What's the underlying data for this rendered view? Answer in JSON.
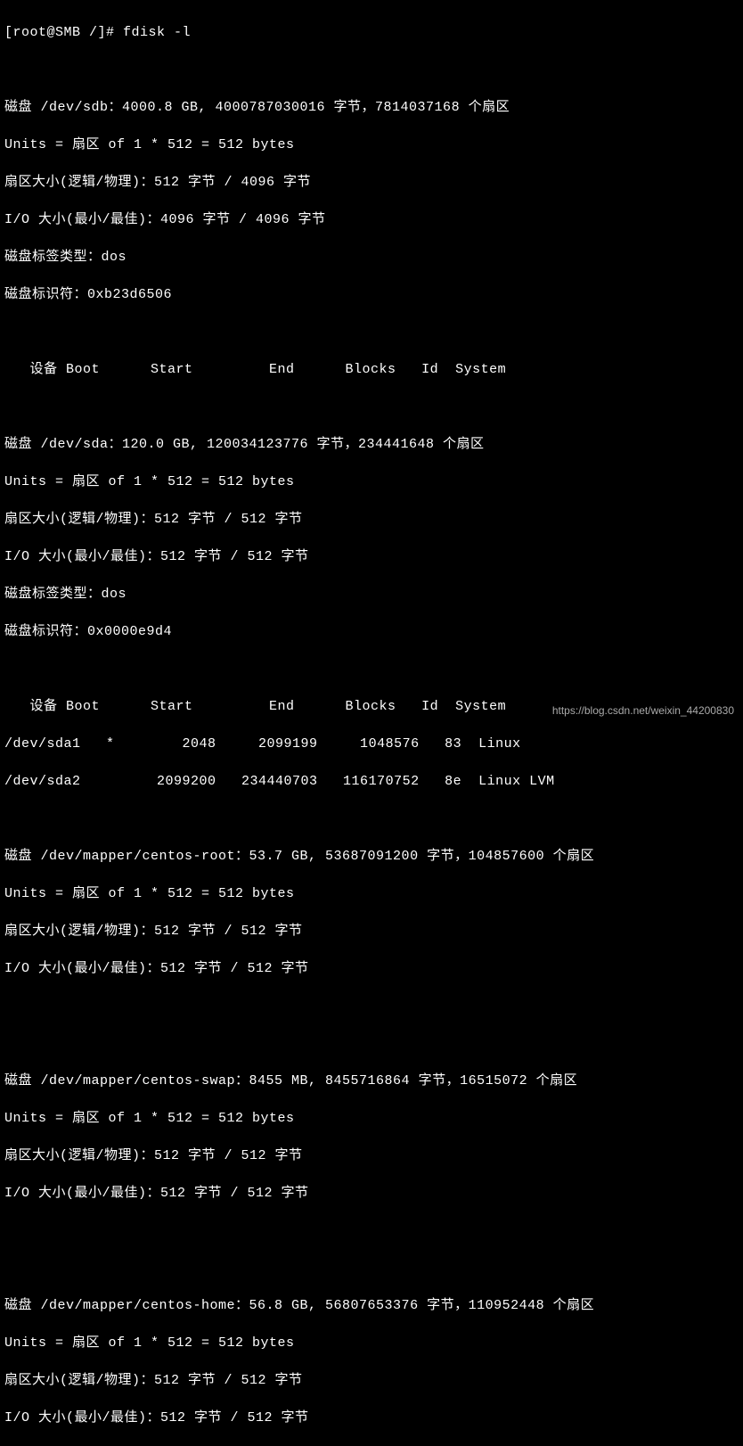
{
  "prompt": "[root@SMB /]# fdisk -l",
  "blank": "",
  "disk_sdb": {
    "header": "磁盘 /dev/sdb：4000.8 GB, 4000787030016 字节，7814037168 个扇区",
    "units": "Units = 扇区 of 1 * 512 = 512 bytes",
    "sector_size": "扇区大小(逻辑/物理)：512 字节 / 4096 字节",
    "io_size": "I/O 大小(最小/最佳)：4096 字节 / 4096 字节",
    "label_type": "磁盘标签类型：dos",
    "identifier": "磁盘标识符：0xb23d6506",
    "table_header": "   设备 Boot      Start         End      Blocks   Id  System"
  },
  "disk_sda": {
    "header": "磁盘 /dev/sda：120.0 GB, 120034123776 字节，234441648 个扇区",
    "units": "Units = 扇区 of 1 * 512 = 512 bytes",
    "sector_size": "扇区大小(逻辑/物理)：512 字节 / 512 字节",
    "io_size": "I/O 大小(最小/最佳)：512 字节 / 512 字节",
    "label_type": "磁盘标签类型：dos",
    "identifier": "磁盘标识符：0x0000e9d4",
    "table_header": "   设备 Boot      Start         End      Blocks   Id  System",
    "row1": "/dev/sda1   *        2048     2099199     1048576   83  Linux",
    "row2": "/dev/sda2         2099200   234440703   116170752   8e  Linux LVM"
  },
  "disk_centos_root": {
    "header": "磁盘 /dev/mapper/centos-root：53.7 GB, 53687091200 字节，104857600 个扇区",
    "units": "Units = 扇区 of 1 * 512 = 512 bytes",
    "sector_size": "扇区大小(逻辑/物理)：512 字节 / 512 字节",
    "io_size": "I/O 大小(最小/最佳)：512 字节 / 512 字节"
  },
  "disk_centos_swap": {
    "header": "磁盘 /dev/mapper/centos-swap：8455 MB, 8455716864 字节，16515072 个扇区",
    "units": "Units = 扇区 of 1 * 512 = 512 bytes",
    "sector_size": "扇区大小(逻辑/物理)：512 字节 / 512 字节",
    "io_size": "I/O 大小(最小/最佳)：512 字节 / 512 字节"
  },
  "disk_centos_home": {
    "header": "磁盘 /dev/mapper/centos-home：56.8 GB, 56807653376 字节，110952448 个扇区",
    "units": "Units = 扇区 of 1 * 512 = 512 bytes",
    "sector_size": "扇区大小(逻辑/物理)：512 字节 / 512 字节",
    "io_size": "I/O 大小(最小/最佳)：512 字节 / 512 字节"
  },
  "watermark": "https://blog.csdn.net/weixin_44200830"
}
